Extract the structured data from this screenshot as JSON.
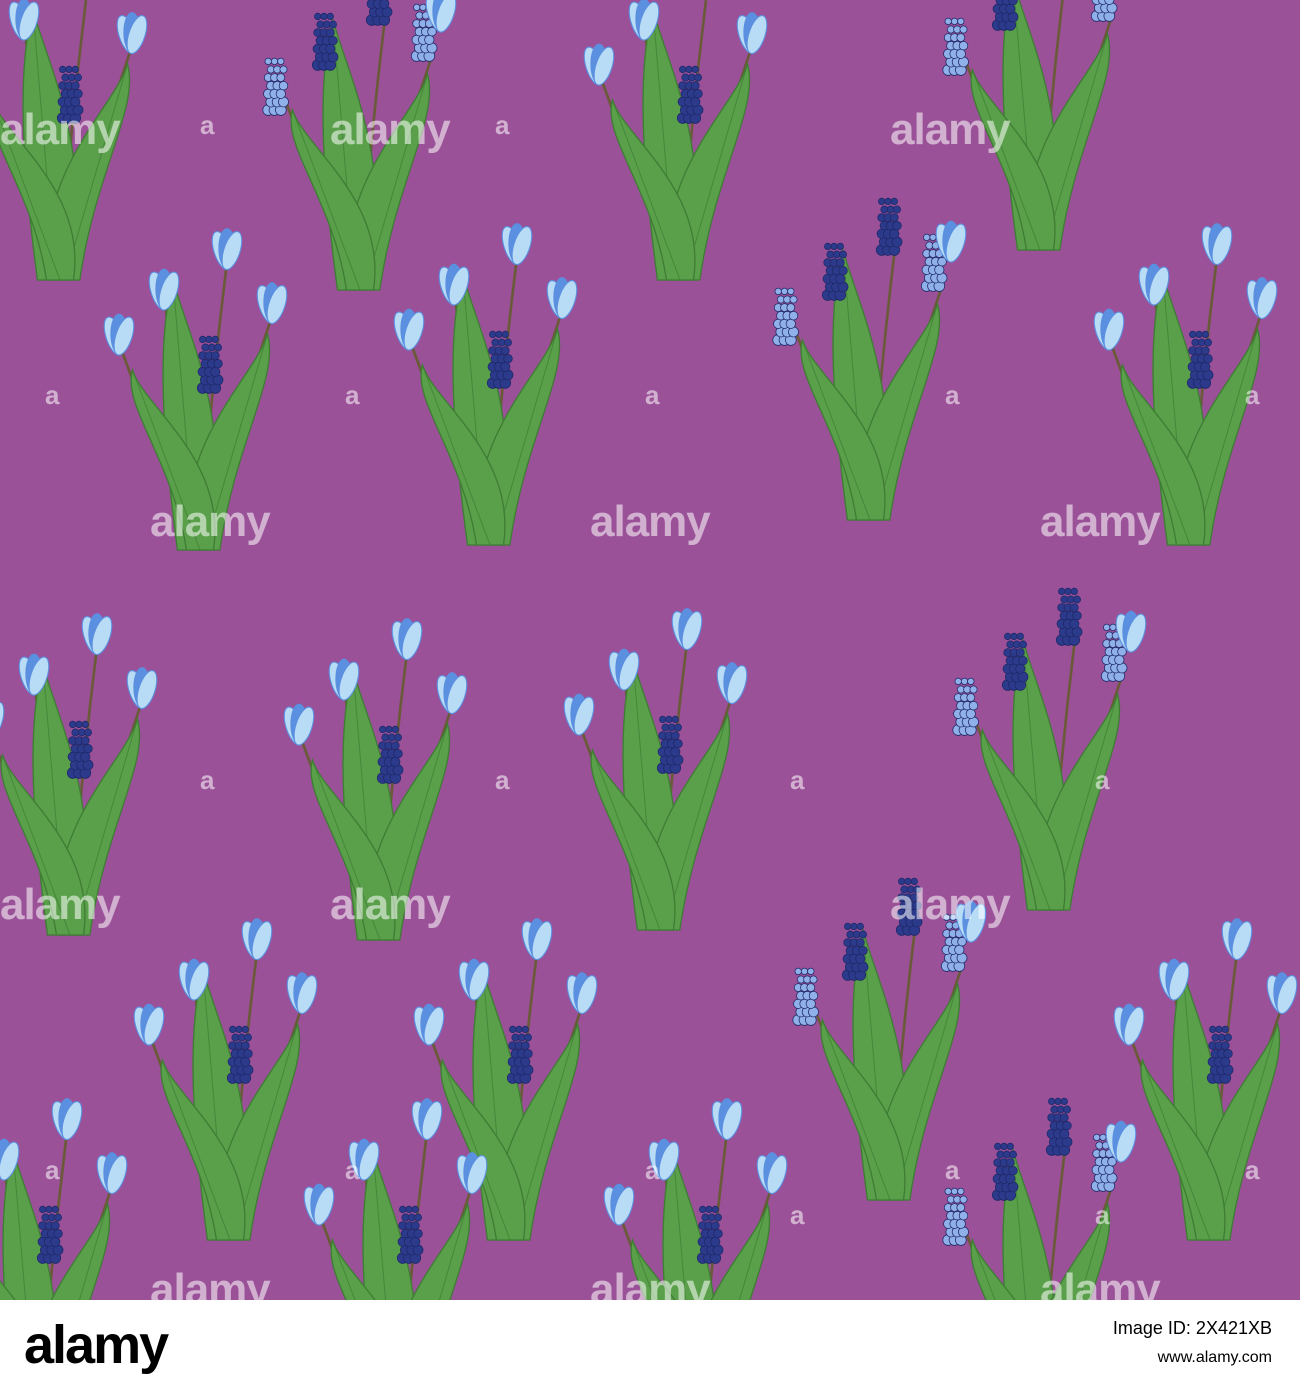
{
  "image": {
    "background_color": "#9a5198",
    "watermark_text": "alamy",
    "footer": {
      "logo_text": "alamy",
      "image_id_label": "Image ID: 2X421XB",
      "site_url": "www.alamy.com"
    },
    "colors": {
      "leaf": "#5aa04a",
      "leaf_dark": "#3f7d34",
      "stem": "#6b5a3a",
      "scilla_light": "#b8dcf5",
      "scilla_mid": "#5b8fe0",
      "muscari_dark": "#2c3a8c",
      "muscari_light": "#8fb0e8"
    }
  }
}
